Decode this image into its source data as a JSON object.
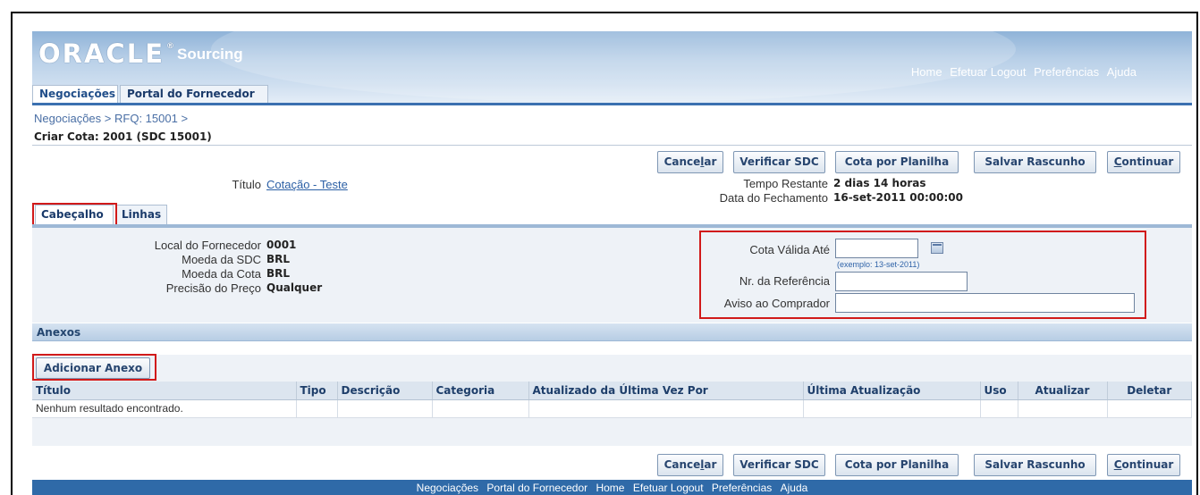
{
  "header": {
    "logo_text": "ORACLE",
    "product": "Sourcing",
    "global_links": [
      "Home",
      "Efetuar Logout",
      "Preferências",
      "Ajuda"
    ]
  },
  "tabs": [
    {
      "label": "Negociações",
      "active": true
    },
    {
      "label": "Portal do Fornecedor",
      "active": false
    }
  ],
  "breadcrumb": [
    "Negociações",
    ">",
    "RFQ: 15001",
    ">"
  ],
  "page_title": "Criar Cota: 2001 (SDC 15001)",
  "buttons": {
    "cancel": {
      "pre": "Cance",
      "u": "l",
      "post": "ar"
    },
    "verify": "Verificar SDC",
    "spreadsheet": "Cota por Planilha",
    "save_draft": "Salvar Rascunho",
    "continue": {
      "u": "C",
      "post": "ontinuar"
    }
  },
  "summary": {
    "title_label": "Título",
    "title_value": "Cotação - Teste",
    "time_left_label": "Tempo Restante",
    "time_left_value": "2 dias 14 horas",
    "close_date_label": "Data do Fechamento",
    "close_date_value": "16-set-2011 00:00:00"
  },
  "subtabs": [
    {
      "label": "Cabeçalho",
      "active": true
    },
    {
      "label": "Linhas",
      "active": false
    }
  ],
  "header_fields": {
    "supplier_site_label": "Local do Fornecedor",
    "supplier_site_value": "0001",
    "rfq_currency_label": "Moeda da SDC",
    "rfq_currency_value": "BRL",
    "quote_currency_label": "Moeda da Cota",
    "quote_currency_value": "BRL",
    "price_precision_label": "Precisão do Preço",
    "price_precision_value": "Qualquer",
    "valid_until_label": "Cota Válida Até",
    "valid_until_value": "",
    "valid_until_hint": "(exemplo: 13-set-2011)",
    "reference_label": "Nr. da Referência",
    "reference_value": "",
    "note_label": "Aviso ao Comprador",
    "note_value": ""
  },
  "attachments": {
    "section_title": "Anexos",
    "add_button": "Adicionar Anexo",
    "columns": [
      "Título",
      "Tipo",
      "Descrição",
      "Categoria",
      "Atualizado da Última Vez Por",
      "Última Atualização",
      "Uso",
      "Atualizar",
      "Deletar"
    ],
    "empty_message": "Nenhum resultado encontrado."
  },
  "footer_links": [
    "Negociações",
    "Portal do Fornecedor",
    "Home",
    "Efetuar Logout",
    "Preferências",
    "Ajuda"
  ],
  "colors": {
    "header_blue": "#8fb3d8",
    "footer_blue": "#2f6aa8",
    "highlight_red": "#d11a1a",
    "link_blue": "#2b5fa5"
  }
}
